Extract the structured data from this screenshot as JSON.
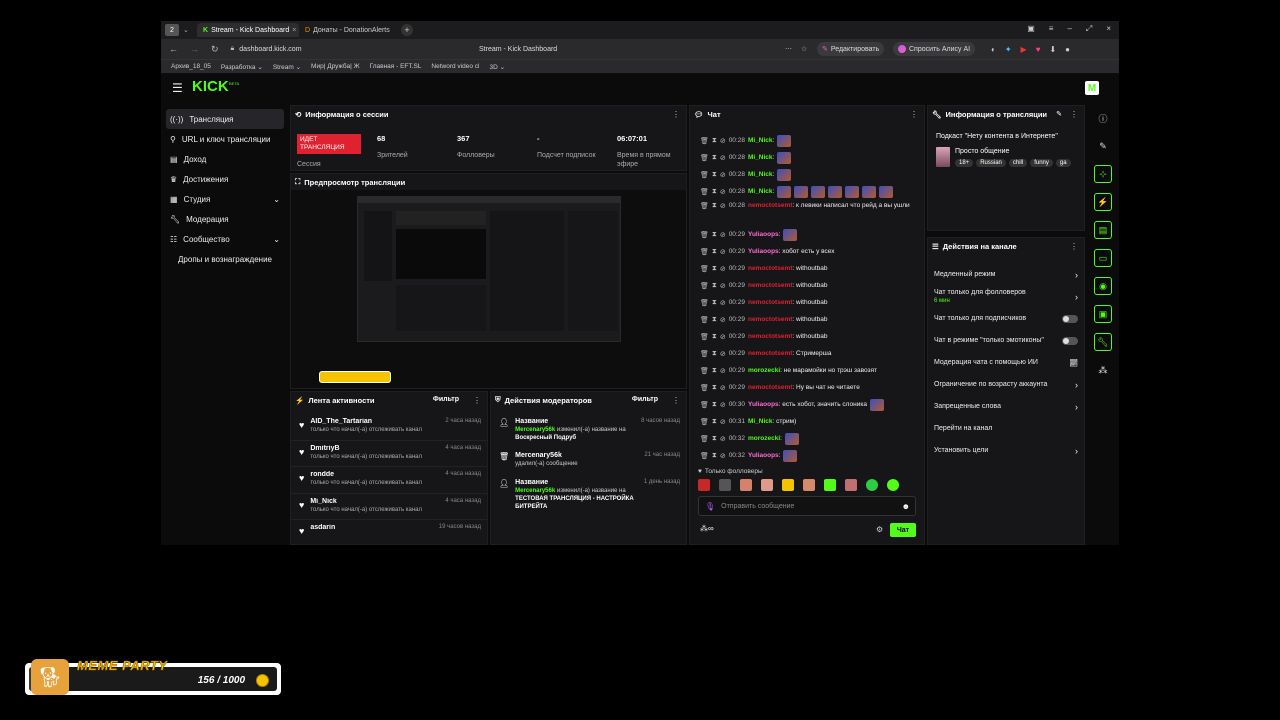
{
  "browser": {
    "tab_count": "2",
    "tabs": [
      {
        "label": "Stream - Kick Dashboard"
      },
      {
        "label": "Донаты - DonationAlerts"
      }
    ],
    "url": "dashboard.kick.com",
    "page_title": "Stream - Kick Dashboard",
    "edit_label": "Редактировать",
    "alice_label": "Спросить Алису AI",
    "bookmarks": [
      "Архив_18_05",
      "Разработка",
      "Stream",
      "Мир| Дружба| Ж",
      "Главная - EFT.SL",
      "Netword video cl",
      "3D"
    ]
  },
  "kick": {
    "logo": "KICK",
    "logo_badge": "BETA"
  },
  "sidebar": {
    "items": [
      {
        "label": "Трансляция",
        "icon": "broadcast-icon"
      },
      {
        "label": "URL и ключ трансляции",
        "icon": "link-icon"
      },
      {
        "label": "Доход",
        "icon": "income-icon"
      },
      {
        "label": "Достижения",
        "icon": "trophy-icon"
      },
      {
        "label": "Студия",
        "icon": "studio-icon"
      },
      {
        "label": "Модерация",
        "icon": "wrench-icon"
      },
      {
        "label": "Сообщество",
        "icon": "community-icon"
      },
      {
        "label": "Дропы и вознаграждение",
        "icon": ""
      }
    ]
  },
  "session": {
    "title": "Информация о сессии",
    "live_badge": "ИДЕТ ТРАНСЛЯЦИЯ",
    "session_label": "Сессия",
    "viewers_value": "68",
    "viewers_label": "Зрителей",
    "followers_value": "367",
    "followers_label": "Фолловеры",
    "subs_value": "-",
    "subs_label": "Подсчет подписок",
    "uptime_value": "06:07:01",
    "uptime_label": "Время в прямом эфире"
  },
  "preview": {
    "title": "Предпросмотр трансляции"
  },
  "activity": {
    "title": "Лента активности",
    "filter": "Фильтр",
    "items": [
      {
        "name": "AID_The_Tartarian",
        "desc": "только что начал(-а) отслеживать канал",
        "time": "2 часа назад"
      },
      {
        "name": "DmitriyB",
        "desc": "только что начал(-а) отслеживать канал",
        "time": "4 часа назад"
      },
      {
        "name": "rondde",
        "desc": "только что начал(-а) отслеживать канал",
        "time": "4 часа назад"
      },
      {
        "name": "Mi_Nick",
        "desc": "только что начал(-а) отслеживать канал",
        "time": "4 часа назад"
      },
      {
        "name": "asdarin",
        "desc": "",
        "time": "19 часов назад"
      }
    ]
  },
  "moderators": {
    "title": "Действия модераторов",
    "filter": "Фильтр",
    "items": [
      {
        "title": "Название",
        "user": "Mercenary56k",
        "action": "изменил(-а) название на",
        "detail": "Воскресный Подруб",
        "time": "8 часов назад"
      },
      {
        "title": "Mercenary56k",
        "user": "",
        "action": "удалил(-а) сообщение",
        "detail": "",
        "time": "21 час назад"
      },
      {
        "title": "Название",
        "user": "Mercenary56k",
        "action": "изменил(-а) название на",
        "detail": "ТЕСТОВАЯ ТРАНСЛЯЦИЯ - НАСТРОЙКА БИТРЕЙТА",
        "time": "1 день назад"
      }
    ]
  },
  "chat": {
    "title": "Чат",
    "messages": [
      {
        "time": "00:28",
        "user": "Mi_Nick",
        "color": "green",
        "text": "",
        "emotes": 1
      },
      {
        "time": "00:28",
        "user": "Mi_Nick",
        "color": "green",
        "text": "",
        "emotes": 1
      },
      {
        "time": "00:28",
        "user": "Mi_Nick",
        "color": "green",
        "text": "",
        "emotes": 1
      },
      {
        "time": "00:28",
        "user": "Mi_Nick",
        "color": "green",
        "text": "",
        "emotes": 7
      },
      {
        "time": "00:28",
        "user": "nemoctotsemt",
        "color": "red",
        "text": "к левики написал что рейд а вы ушли",
        "emotes": 0
      },
      {
        "time": "00:29",
        "user": "Yuliaoops",
        "color": "pink",
        "text": "",
        "emotes": 1
      },
      {
        "time": "00:29",
        "user": "Yuliaoops",
        "color": "pink",
        "text": "хобот есть у всех",
        "emotes": 0
      },
      {
        "time": "00:29",
        "user": "nemoctotsemt",
        "color": "red",
        "text": "withoutbab",
        "emotes": 0
      },
      {
        "time": "00:29",
        "user": "nemoctotsemt",
        "color": "red",
        "text": "withoutbab",
        "emotes": 0
      },
      {
        "time": "00:29",
        "user": "nemoctotsemt",
        "color": "red",
        "text": "withoutbab",
        "emotes": 0
      },
      {
        "time": "00:29",
        "user": "nemoctotsemt",
        "color": "red",
        "text": "withoutbab",
        "emotes": 0
      },
      {
        "time": "00:29",
        "user": "nemoctotsemt",
        "color": "red",
        "text": "withoutbab",
        "emotes": 0
      },
      {
        "time": "00:29",
        "user": "nemoctotsemt",
        "color": "red",
        "text": "Стримерша",
        "emotes": 0
      },
      {
        "time": "00:29",
        "user": "morozecki",
        "color": "green",
        "text": "не марамойки но трэш завозят",
        "emotes": 0
      },
      {
        "time": "00:29",
        "user": "nemoctotsemt",
        "color": "red",
        "text": "Ну вы чат не читаете",
        "emotes": 0
      },
      {
        "time": "00:30",
        "user": "Yuliaoops",
        "color": "pink",
        "text": "есть хобот, значить слоника",
        "emotes": 1
      },
      {
        "time": "00:31",
        "user": "Mi_Nick",
        "color": "green",
        "text": "стрим)",
        "emotes": 0
      },
      {
        "time": "00:32",
        "user": "morozecki",
        "color": "green",
        "text": "",
        "emotes": 1
      },
      {
        "time": "00:32",
        "user": "Yuliaoops",
        "color": "pink",
        "text": "",
        "emotes": 1
      }
    ],
    "followers_only": "Только фолловеры",
    "input_placeholder": "Отправить сообщение",
    "send_label": "Чат"
  },
  "stream_info": {
    "title": "Информация о трансляции",
    "stream_title": "Подкаст \"Нету контента в Интернете\"",
    "category": "Просто общение",
    "tags": [
      "18+",
      "Russian",
      "chill",
      "funny",
      "ga"
    ]
  },
  "channel_actions": {
    "title": "Действия на канале",
    "items": [
      {
        "label": "Медленный режим",
        "sub": "",
        "control": "chevron"
      },
      {
        "label": "Чат только для фолловеров",
        "sub": "6 мин",
        "control": "chevron"
      },
      {
        "label": "Чат только для подписчиков",
        "sub": "",
        "control": "toggle"
      },
      {
        "label": "Чат в режиме \"только эмотиконы\"",
        "sub": "",
        "control": "toggle"
      },
      {
        "label": "Модерация чата с помощью ИИ",
        "sub": "",
        "control": "chart"
      },
      {
        "label": "Ограничение по возрасту аккаунта",
        "sub": "",
        "control": "chevron"
      },
      {
        "label": "Запрещенные слова",
        "sub": "",
        "control": "chevron"
      },
      {
        "label": "Перейти на канал",
        "sub": "",
        "control": "none"
      },
      {
        "label": "Установить цели",
        "sub": "",
        "control": "chevron"
      }
    ]
  },
  "overlay": {
    "title": "MEME PARTY",
    "progress_text": "156 / 1000",
    "progress_fraction": 0.156,
    "accent": "#f5c400"
  },
  "colors": {
    "kick_green": "#53fc18",
    "live_red": "#e0212f",
    "bg": "#0b0b0c",
    "panel": "#161618"
  }
}
